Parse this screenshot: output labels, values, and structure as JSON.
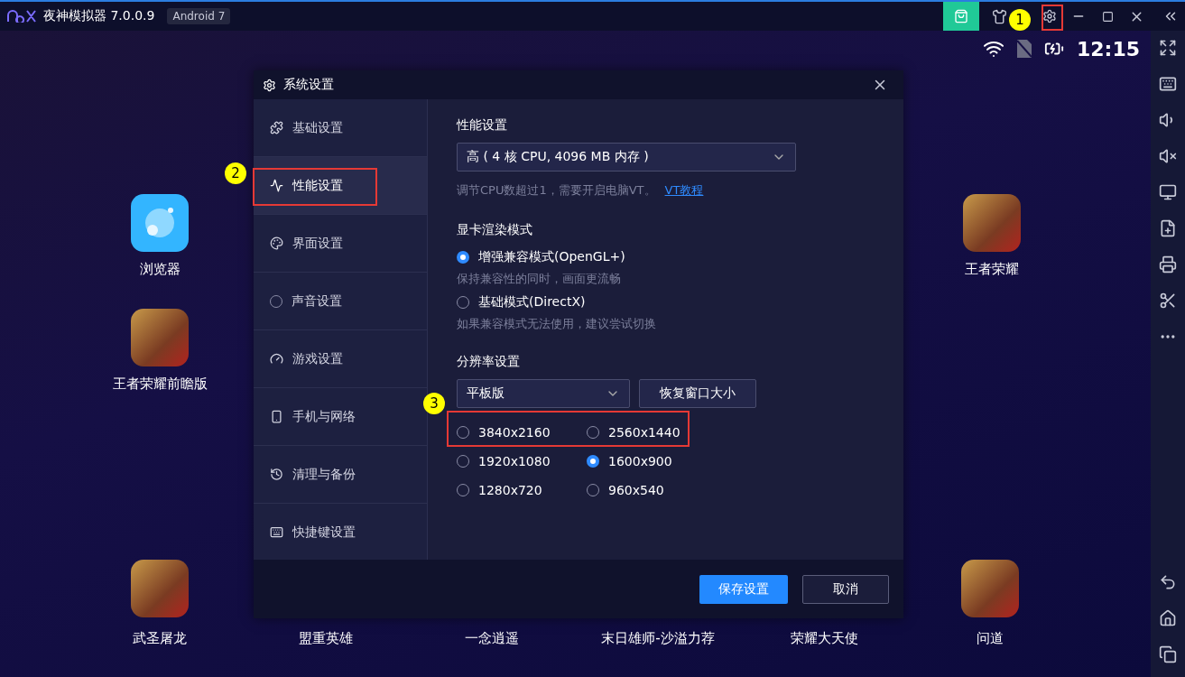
{
  "app": {
    "title": "夜神模拟器 7.0.0.9",
    "badge": "Android 7"
  },
  "status_bar": {
    "time": "12:15"
  },
  "desktop": {
    "apps": [
      {
        "label": "浏览器",
        "kind": "browser"
      },
      {
        "label": "王者荣耀前瞻版",
        "kind": "game"
      },
      {
        "label": "王者荣耀",
        "kind": "game"
      }
    ],
    "dock": [
      {
        "label": "武圣屠龙",
        "kind": "game"
      },
      {
        "label": "盟重英雄",
        "kind": "game"
      },
      {
        "label": "一念逍遥",
        "kind": "game"
      },
      {
        "label": "末日雄师-沙溢力荐",
        "kind": "game"
      },
      {
        "label": "荣耀大天使",
        "kind": "game"
      },
      {
        "label": "问道",
        "kind": "game"
      }
    ]
  },
  "dialog": {
    "title": "系统设置",
    "nav": [
      {
        "label": "基础设置",
        "selected": false
      },
      {
        "label": "性能设置",
        "selected": true
      },
      {
        "label": "界面设置",
        "selected": false
      },
      {
        "label": "声音设置",
        "selected": false
      },
      {
        "label": "游戏设置",
        "selected": false
      },
      {
        "label": "手机与网络",
        "selected": false
      },
      {
        "label": "清理与备份",
        "selected": false
      },
      {
        "label": "快捷键设置",
        "selected": false
      }
    ],
    "performance": {
      "heading": "性能设置",
      "value": "高 ( 4 核 CPU, 4096 MB 内存 )",
      "hint": "调节CPU数超过1，需要开启电脑VT。",
      "link": "VT教程"
    },
    "graphics": {
      "heading": "显卡渲染模式",
      "options": [
        {
          "label": "增强兼容模式(OpenGL+)",
          "hint": "保持兼容性的同时，画面更流畅",
          "selected": true
        },
        {
          "label": "基础模式(DirectX)",
          "hint": "如果兼容模式无法使用，建议尝试切换",
          "selected": false
        }
      ]
    },
    "resolution": {
      "heading": "分辨率设置",
      "preset": "平板版",
      "reset_button": "恢复窗口大小",
      "options": [
        {
          "label": "3840x2160",
          "selected": false
        },
        {
          "label": "2560x1440",
          "selected": false
        },
        {
          "label": "1920x1080",
          "selected": false
        },
        {
          "label": "1600x900",
          "selected": true
        },
        {
          "label": "1280x720",
          "selected": false
        },
        {
          "label": "960x540",
          "selected": false
        }
      ]
    },
    "buttons": {
      "save": "保存设置",
      "cancel": "取消"
    }
  },
  "annotations": [
    "1",
    "2",
    "3"
  ]
}
